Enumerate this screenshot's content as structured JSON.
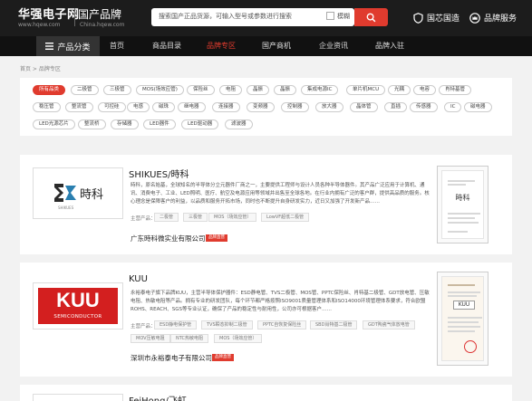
{
  "header": {
    "logo_main": "华强电子网",
    "logo_sub": "www.hqew.com",
    "logo_guochan": "国产品牌",
    "logo_guochan_sub": "China.hqew.com",
    "search_placeholder": "搜索国产正品货源，可输入型号或参数进行搜索",
    "fuzzy_label": "模糊",
    "link_guoxin": "国芯国造",
    "link_service": "品牌服务"
  },
  "nav": {
    "category": "产品分类",
    "items": [
      "首页",
      "商品目录",
      "品牌专区",
      "国产商机",
      "企业资讯",
      "品牌入驻"
    ],
    "active_index": 2
  },
  "breadcrumb": "首页 > 品牌专区",
  "filter": {
    "tags": [
      "所有品类",
      "二极管",
      "三极管",
      "MOS(场效应管)",
      "保险丝",
      "电阻",
      "晶振",
      "晶振",
      "集成电源IC",
      "单片机MCU",
      "光耦",
      "电容",
      "肖特基管",
      "稳压管",
      "整流管",
      "可控硅",
      "电感",
      "磁珠",
      "继电器",
      "连接器",
      "变频器",
      "控制器",
      "放大器",
      "晶体管",
      "直插",
      "传感器",
      "IC",
      "磁电器",
      "LED光源芯片",
      "整流桥",
      "存储器",
      "LED器件",
      "LED驱动器",
      "滤波器"
    ],
    "active_index": 0
  },
  "cards": [
    {
      "title": "SHIKUES/時科",
      "logo_text": "時科",
      "logo_sub": "SHIKUES",
      "desc": "時科，原名始基，全球知名的半导体分立元器件厂商之一，主要提供工程师与设计人员各种半导体器件。其产品广泛应用于计算机、通讯、消费电子、工业、LED照明、医疗、航空及电源应用等领域并出售至全球各地。在行业内拥有广泛的客户群，提供高品质的服务。核心理念是保障客户的利益，以品质和服务开拓市场，同时也不断提升自身研发实力，近日又加强了开发新产品……",
      "prod_label": "主营产品：",
      "products": [
        "二极管",
        "三极管",
        "MOS（场效应管）",
        "LowVF超低二极管"
      ],
      "company": "广东時科微实业有限公司",
      "badge": "品牌直营",
      "cert_title": "時科"
    },
    {
      "title": "KUU",
      "logo_text": "KUU",
      "logo_sub": "SEMICONDUCTOR",
      "desc": "永裕泰电子旗下品牌KUU，主营半导体保护器件：ESD静电管、TVS二极管、MOS管、PPTC保险丝、肖特基二极管、GDT放电管、压敏电阻、热敏电阻等产品。拥有专业的研发团队，每个环节都严格按照ISO9001质量管理体系和ISO14000环境管理体系要求，符合欧盟ROHS、REACH、SGS等专业认证，确保了产品的稳定性与耐用性，公司亦可根据客户……",
      "prod_label": "主营产品：",
      "products": [
        "ESD静电保护管",
        "TVS瞬态抑制二极管",
        "PPTC自恢复保险丝",
        "SBD肖特基二极管",
        "GDT陶瓷气体放电管",
        "MOV压敏电阻",
        "NTC热敏电阻",
        "MOS（场效应管）"
      ],
      "company": "深圳市永裕泰电子有限公司",
      "badge": "品牌直营",
      "cert_title": "KUU"
    },
    {
      "title": "FeiHong/飞虹"
    }
  ],
  "colors": {
    "accent": "#e03b2e",
    "topbar": "#1c1c1c",
    "nav": "#111111"
  }
}
